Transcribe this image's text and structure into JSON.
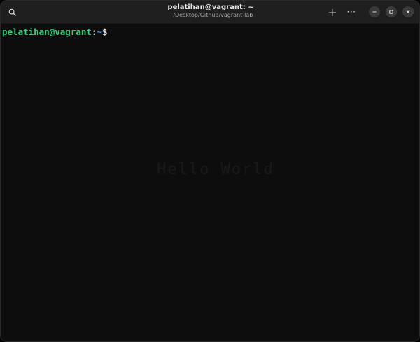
{
  "window": {
    "title": "pelatihan@vagrant: ~",
    "subtitle": "~/Desktop/Github/vagrant-lab"
  },
  "toolbar": {
    "search_icon": "search-icon",
    "new_tab_icon": "plus-icon",
    "menu_icon": "ellipsis-icon",
    "new_tab_glyph": "+",
    "menu_glyph": "···"
  },
  "window_controls": {
    "minimize_icon": "minimize-icon",
    "maximize_icon": "maximize-icon",
    "close_icon": "close-icon"
  },
  "terminal": {
    "prompt": {
      "user_host": "pelatihan@vagrant",
      "separator": ":",
      "path": "~",
      "symbol": "$"
    },
    "watermark": "Hello World"
  },
  "colors": {
    "background": "#0d0d0d",
    "titlebar": "#1f1f1f",
    "user_host": "#33d17a",
    "path": "#3f8fe0",
    "text": "#e6e6e6"
  }
}
